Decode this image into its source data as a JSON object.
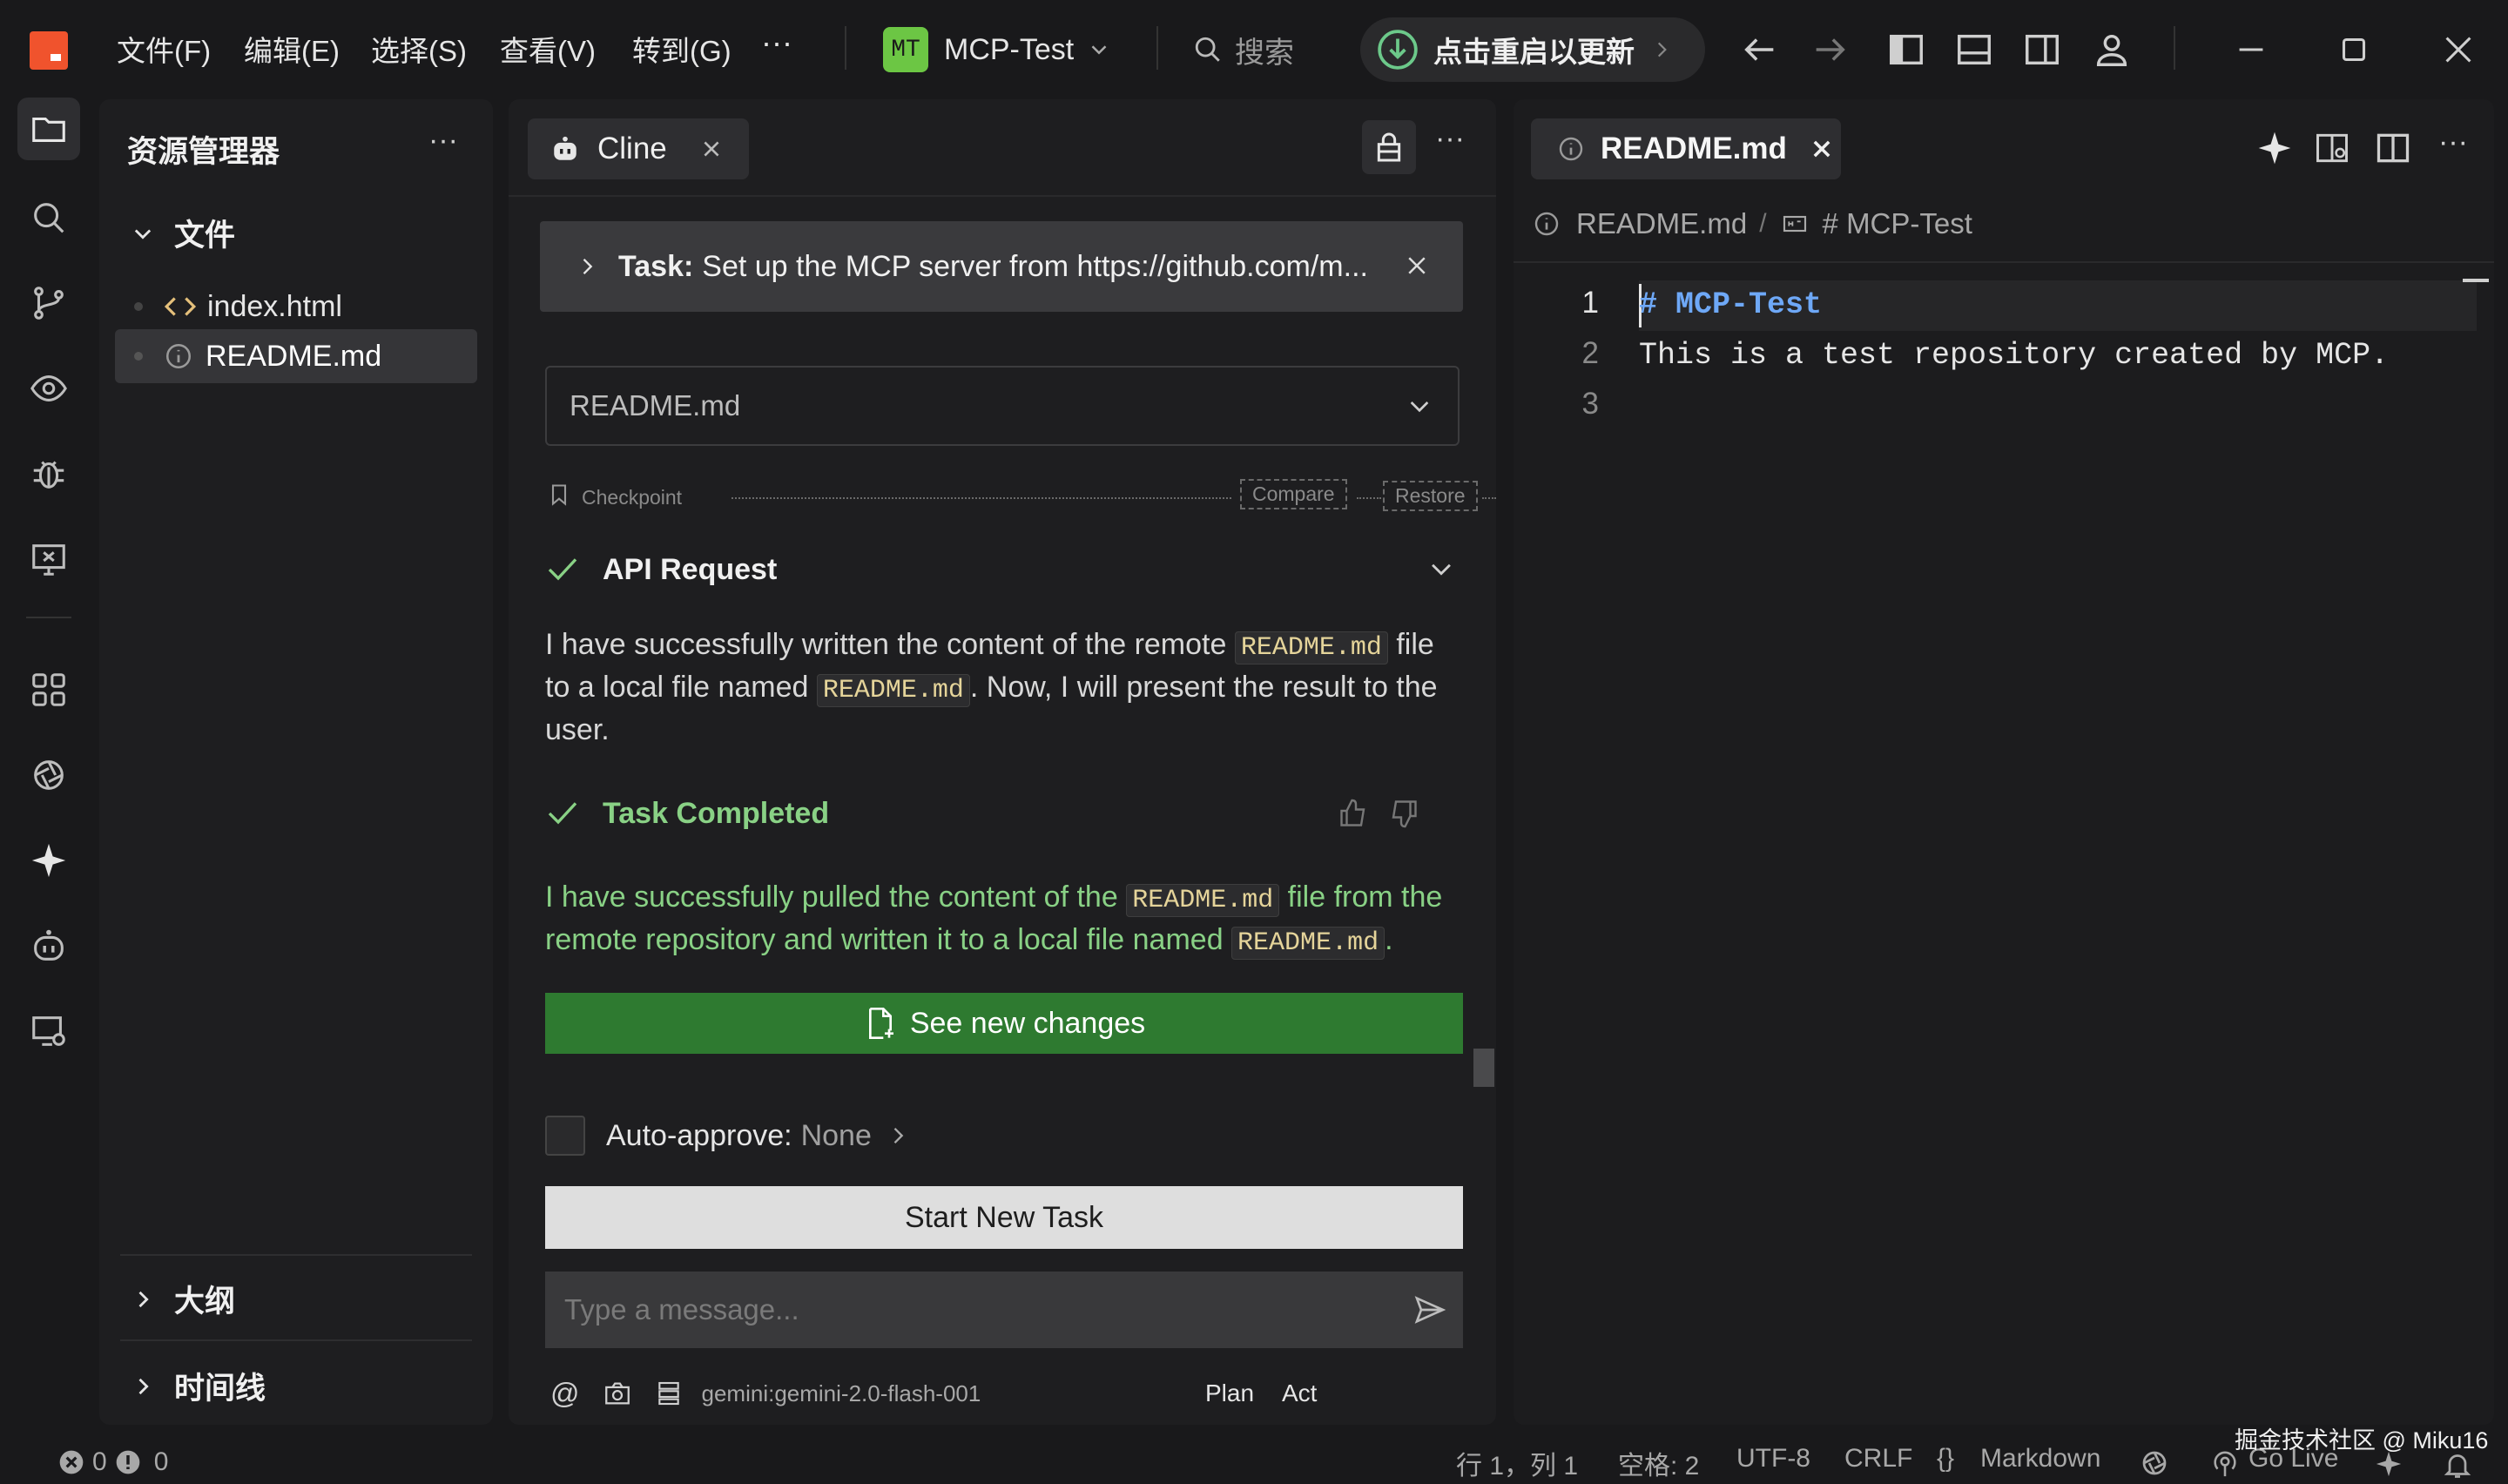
{
  "titlebar": {
    "menus": [
      "文件(F)",
      "编辑(E)",
      "选择(S)",
      "查看(V)",
      "转到(G)"
    ],
    "more": "···",
    "workspace_badge": "MT",
    "workspace_name": "MCP-Test",
    "search_placeholder": "搜索",
    "update_label": "点击重启以更新"
  },
  "explorer": {
    "title": "资源管理器",
    "more": "···",
    "folder_label": "文件",
    "files": [
      {
        "name": "index.html",
        "icon": "code-brackets-icon"
      },
      {
        "name": "README.md",
        "icon": "info-circle-icon"
      }
    ],
    "outline_label": "大纲",
    "timeline_label": "时间线"
  },
  "cline": {
    "tab_label": "Cline",
    "task_prefix": "Task:",
    "task_text": "Set up the MCP server from https://github.com/m...",
    "dropdown_value": "README.md",
    "checkpoint_label": "Checkpoint",
    "compare_label": "Compare",
    "restore_label": "Restore",
    "api_request_label": "API Request",
    "message1": {
      "p1": "I have successfully written the content of the remote ",
      "code1": "README.md",
      "p2": " file to a local file named ",
      "code2": "README.md",
      "p3": ". Now, I will present the result to the user."
    },
    "task_completed_label": "Task Completed",
    "message2": {
      "p1": "I have successfully pulled the content of the ",
      "code1": "README.md",
      "p2": " file from the remote repository and written it to a local file named ",
      "code2": "README.md",
      "p3": "."
    },
    "see_changes_label": "See new changes",
    "auto_approve_label": "Auto-approve:",
    "auto_approve_value": "None",
    "start_new_task_label": "Start New Task",
    "input_placeholder": "Type a message...",
    "model_label": "gemini:gemini-2.0-flash-001",
    "plan_label": "Plan",
    "act_label": "Act"
  },
  "editor": {
    "tab_label": "README.md",
    "breadcrumb_file": "README.md",
    "breadcrumb_sep": "/",
    "breadcrumb_heading": "# MCP-Test",
    "lines": [
      {
        "num": "1",
        "text": "# MCP-Test"
      },
      {
        "num": "2",
        "text": "This is a test repository created by MCP."
      },
      {
        "num": "3",
        "text": ""
      }
    ]
  },
  "statusbar": {
    "errors": "0",
    "warnings": "0",
    "position": "行 1，列 1",
    "spaces": "空格: 2",
    "encoding": "UTF-8",
    "eol": "CRLF",
    "language_icon": "{}",
    "language": "Markdown",
    "golive": "Go Live",
    "watermark": "掘金技术社区 @ Miku16"
  },
  "colors": {
    "accent_green": "#2e7a30",
    "success_green": "#89d185",
    "code_yellow": "#e5d49a",
    "heading_blue": "#6ea8f7",
    "app_icon_red": "#f0532d"
  }
}
